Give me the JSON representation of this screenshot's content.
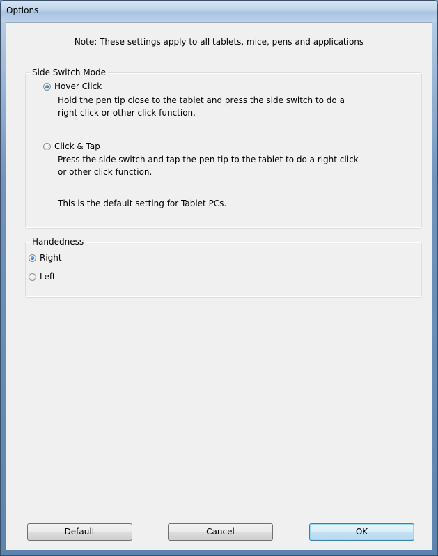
{
  "window": {
    "title": "Options"
  },
  "note": "Note: These settings apply to all tablets, mice, pens and applications",
  "side_switch_mode": {
    "label": "Side Switch Mode",
    "options": [
      {
        "label": "Hover Click",
        "checked": true,
        "description_lines": [
          "Hold the pen tip close to the tablet and press the side switch to do a",
          "right click or other click function."
        ]
      },
      {
        "label": "Click & Tap",
        "checked": false,
        "description_lines": [
          "Press the side switch and tap the pen tip to the tablet to do a right click",
          "or other click function."
        ],
        "extra_note": "This is the default setting for Tablet PCs."
      }
    ]
  },
  "handedness": {
    "label": "Handedness",
    "options": [
      {
        "label": "Right",
        "checked": true
      },
      {
        "label": "Left",
        "checked": false
      }
    ]
  },
  "buttons": {
    "default": "Default",
    "cancel": "Cancel",
    "ok": "OK"
  },
  "colors": {
    "dialog_background": "#f0f0f0",
    "frame_blue": "#6d8fb5",
    "radio_selected": "#1d6ec4"
  }
}
